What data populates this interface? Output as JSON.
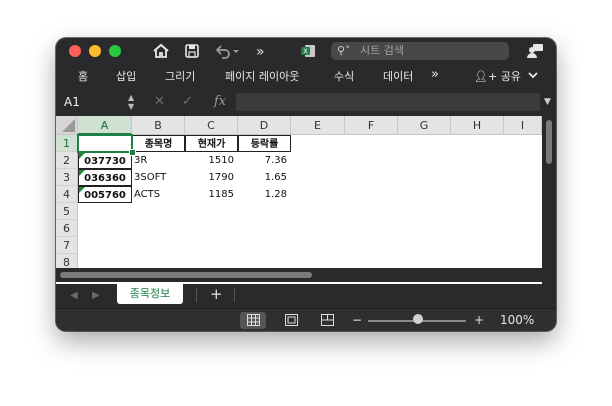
{
  "titlebar": {
    "icons": [
      "home-icon",
      "save-icon",
      "undo-icon",
      "more-icon",
      "excel-icon",
      "share-person-icon"
    ],
    "search_placeholder": "시트 검색"
  },
  "ribbon": {
    "tabs": [
      "홈",
      "삽입",
      "그리기",
      "페이지 레이아웃",
      "수식",
      "데이터"
    ],
    "more": "»",
    "share_label": "공유"
  },
  "formula_bar": {
    "name_box": "A1",
    "fx_label": "fx",
    "formula": ""
  },
  "columns": [
    "A",
    "B",
    "C",
    "D",
    "E",
    "F",
    "G",
    "H",
    "I"
  ],
  "rows": [
    "1",
    "2",
    "3",
    "4",
    "5",
    "6",
    "7",
    "8"
  ],
  "table": {
    "headers": [
      "",
      "종목명",
      "현재가",
      "등락률"
    ],
    "rows": [
      {
        "code": "037730",
        "name": "3R",
        "price": "1510",
        "change": "7.36"
      },
      {
        "code": "036360",
        "name": "3SOFT",
        "price": "1790",
        "change": "1.65"
      },
      {
        "code": "005760",
        "name": "ACTS",
        "price": "1185",
        "change": "1.28"
      }
    ]
  },
  "sheets": {
    "active": "종목정보",
    "add": "+"
  },
  "statusbar": {
    "zoom_minus": "−",
    "zoom_plus": "+",
    "zoom": "100%"
  },
  "colors": {
    "accent": "#1e7e44",
    "window_bg": "#2a2a2c"
  }
}
